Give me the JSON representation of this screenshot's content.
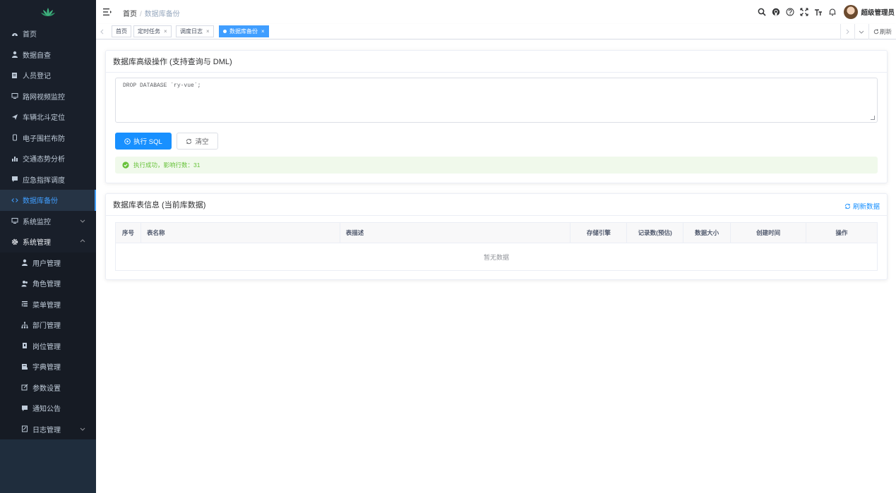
{
  "sidebar": {
    "items": [
      {
        "label": "首页",
        "icon": "dashboard-icon"
      },
      {
        "label": "数据自查",
        "icon": "user-icon"
      },
      {
        "label": "人员登记",
        "icon": "form-icon"
      },
      {
        "label": "路网视频监控",
        "icon": "monitor-icon"
      },
      {
        "label": "车辆北斗定位",
        "icon": "send-icon"
      },
      {
        "label": "电子围栏布防",
        "icon": "phone-icon"
      },
      {
        "label": "交通态势分析",
        "icon": "chart-icon"
      },
      {
        "label": "应急指挥调度",
        "icon": "message-icon"
      },
      {
        "label": "数据库备份",
        "icon": "code-icon"
      },
      {
        "label": "系统监控",
        "icon": "monitor-icon"
      },
      {
        "label": "系统管理",
        "icon": "gear-icon"
      }
    ],
    "sub_items": [
      {
        "label": "用户管理",
        "icon": "user-icon"
      },
      {
        "label": "角色管理",
        "icon": "peoples-icon"
      },
      {
        "label": "菜单管理",
        "icon": "tree-table-icon"
      },
      {
        "label": "部门管理",
        "icon": "tree-icon"
      },
      {
        "label": "岗位管理",
        "icon": "post-icon"
      },
      {
        "label": "字典管理",
        "icon": "dict-icon"
      },
      {
        "label": "参数设置",
        "icon": "edit-icon"
      },
      {
        "label": "通知公告",
        "icon": "message-icon"
      },
      {
        "label": "日志管理",
        "icon": "log-icon"
      }
    ]
  },
  "navbar": {
    "breadcrumb_home": "首页",
    "breadcrumb_sep": "/",
    "breadcrumb_current": "数据库备份",
    "username": "超级管理员"
  },
  "tags": {
    "items": [
      "首页",
      "定时任务",
      "调度日志",
      "数据库备份"
    ],
    "close": "×",
    "refresh": "刷新"
  },
  "sql_card": {
    "title": "数据库高级操作 (支持查询与 DML)",
    "sql_value": "DROP DATABASE `ry-vue`;",
    "execute_label": "执行 SQL",
    "clear_label": "清空",
    "result_message": "执行成功，影响行数：31"
  },
  "table_card": {
    "title": "数据库表信息 (当前库数据)",
    "refresh_label": "刷新数据",
    "columns": [
      "序号",
      "表名称",
      "表描述",
      "存储引擎",
      "记录数(预估)",
      "数据大小",
      "创建时间",
      "操作"
    ],
    "empty_text": "暂无数据"
  },
  "colors": {
    "sidebar_bg": "#191f2a",
    "accent": "#1890ff",
    "success": "#67c23a"
  }
}
